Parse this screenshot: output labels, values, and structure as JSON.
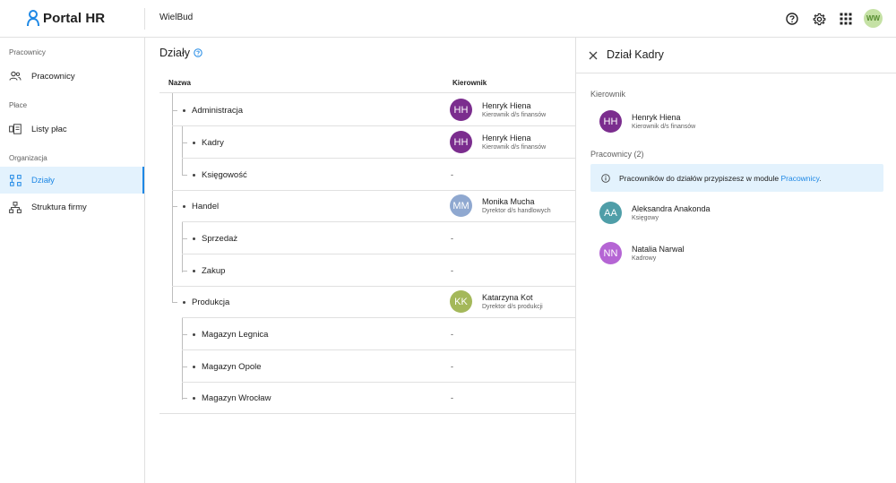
{
  "app": {
    "name": "Portal HR",
    "company": "WielBud",
    "user_initials": "WW"
  },
  "top_icons": [
    "help-icon",
    "settings-icon",
    "apps-grid-icon"
  ],
  "sidebar": {
    "sections": [
      {
        "label": "Pracownicy",
        "items": [
          {
            "label": "Pracownicy",
            "icon": "people-icon"
          }
        ]
      },
      {
        "label": "Płace",
        "items": [
          {
            "label": "Listy płac",
            "icon": "payroll-icon"
          }
        ]
      },
      {
        "label": "Organizacja",
        "items": [
          {
            "label": "Działy",
            "icon": "departments-icon",
            "active": true
          },
          {
            "label": "Struktura firmy",
            "icon": "org-structure-icon"
          }
        ]
      }
    ]
  },
  "main": {
    "title": "Działy",
    "columns": {
      "name": "Nazwa",
      "manager": "Kierownik"
    },
    "rows": [
      {
        "name": "Administracja",
        "level": 0,
        "manager": {
          "initials": "HH",
          "name": "Henryk Hiena",
          "role": "Kierownik d/s finansów",
          "color": "#7b2d8e"
        }
      },
      {
        "name": "Kadry",
        "level": 1,
        "manager": {
          "initials": "HH",
          "name": "Henryk Hiena",
          "role": "Kierownik d/s finansów",
          "color": "#7b2d8e"
        }
      },
      {
        "name": "Księgowość",
        "level": 1,
        "manager": null,
        "empty": "-"
      },
      {
        "name": "Handel",
        "level": 0,
        "manager": {
          "initials": "MM",
          "name": "Monika Mucha",
          "role": "Dyrektor d/s handlowych",
          "color": "#8fa8d0"
        }
      },
      {
        "name": "Sprzedaż",
        "level": 1,
        "manager": null,
        "empty": "-"
      },
      {
        "name": "Zakup",
        "level": 1,
        "manager": null,
        "empty": "-"
      },
      {
        "name": "Produkcja",
        "level": 0,
        "manager": {
          "initials": "KK",
          "name": "Katarzyna Kot",
          "role": "Dyrektor d/s produkcji",
          "color": "#a4b85a"
        }
      },
      {
        "name": "Magazyn Legnica",
        "level": 1,
        "manager": null,
        "empty": "-"
      },
      {
        "name": "Magazyn Opole",
        "level": 1,
        "manager": null,
        "empty": "-"
      },
      {
        "name": "Magazyn Wrocław",
        "level": 1,
        "manager": null,
        "empty": "-"
      }
    ]
  },
  "panel": {
    "title": "Dział Kadry",
    "manager_label": "Kierownik",
    "manager": {
      "initials": "HH",
      "name": "Henryk Hiena",
      "role": "Kierownik d/s finansów",
      "color": "#7b2d8e"
    },
    "employees_label": "Pracownicy (2)",
    "info_text": "Pracowników do działów przypiszesz w module ",
    "info_link": "Pracownicy",
    "info_end": ".",
    "employees": [
      {
        "initials": "AA",
        "name": "Aleksandra Anakonda",
        "role": "Księgowy",
        "color": "#4f9ea8"
      },
      {
        "initials": "NN",
        "name": "Natalia Narwal",
        "role": "Kadrowy",
        "color": "#b565d4"
      }
    ]
  }
}
